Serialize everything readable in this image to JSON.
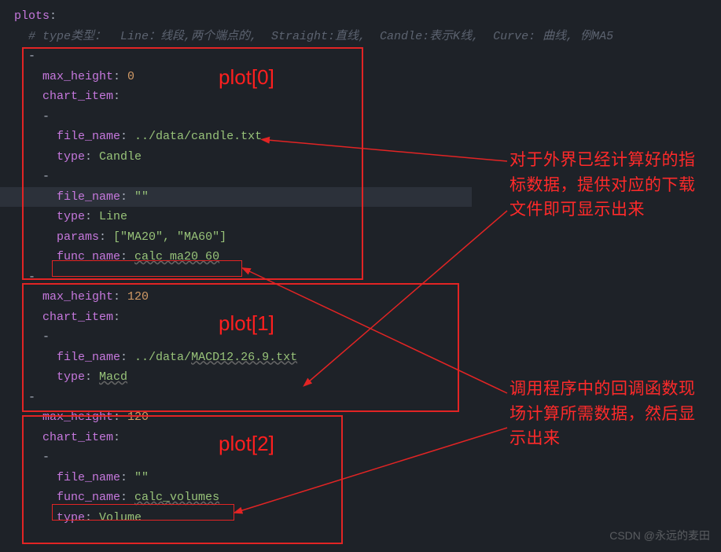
{
  "header": {
    "plots": "plots",
    "colon": ":"
  },
  "comment": "# type类型：  Line：线段,两个端点的,  Straight:直线,  Candle:表示K线,  Curve: 曲线, 例MA5",
  "plot0": {
    "label": "plot[0]",
    "max_height_key": "max_height",
    "max_height_val": "0",
    "chart_item_key": "chart_item",
    "item1": {
      "file_name_key": "file_name",
      "file_name_val": "../data/candle.txt",
      "type_key": "type",
      "type_val": "Candle"
    },
    "item2": {
      "file_name_key": "file_name",
      "file_name_val": "\"\"",
      "type_key": "type",
      "type_val": "Line",
      "params_key": "params",
      "params_val": "[\"MA20\", \"MA60\"]",
      "func_name_key": "func_name",
      "func_name_val": "calc_ma20_60"
    }
  },
  "plot1": {
    "label": "plot[1]",
    "max_height_key": "max_height",
    "max_height_val": "120",
    "chart_item_key": "chart_item",
    "item1": {
      "file_name_key": "file_name",
      "file_name_val": "../data/MACD12.26.9.txt",
      "type_key": "type",
      "type_val": "Macd"
    }
  },
  "plot2": {
    "label": "plot[2]",
    "max_height_key": "max_height",
    "max_height_val": "120",
    "chart_item_key": "chart_item",
    "item1": {
      "file_name_key": "file_name",
      "file_name_val": "\"\"",
      "func_name_key": "func_name",
      "func_name_val": "calc_volumes",
      "type_key": "type",
      "type_val": "Volume"
    }
  },
  "annot1": "对于外界已经计算好的指标数据，提供对应的下载文件即可显示出来",
  "annot2": "调用程序中的回调函数现场计算所需数据，然后显示出来",
  "watermark": "CSDN @永远的麦田"
}
